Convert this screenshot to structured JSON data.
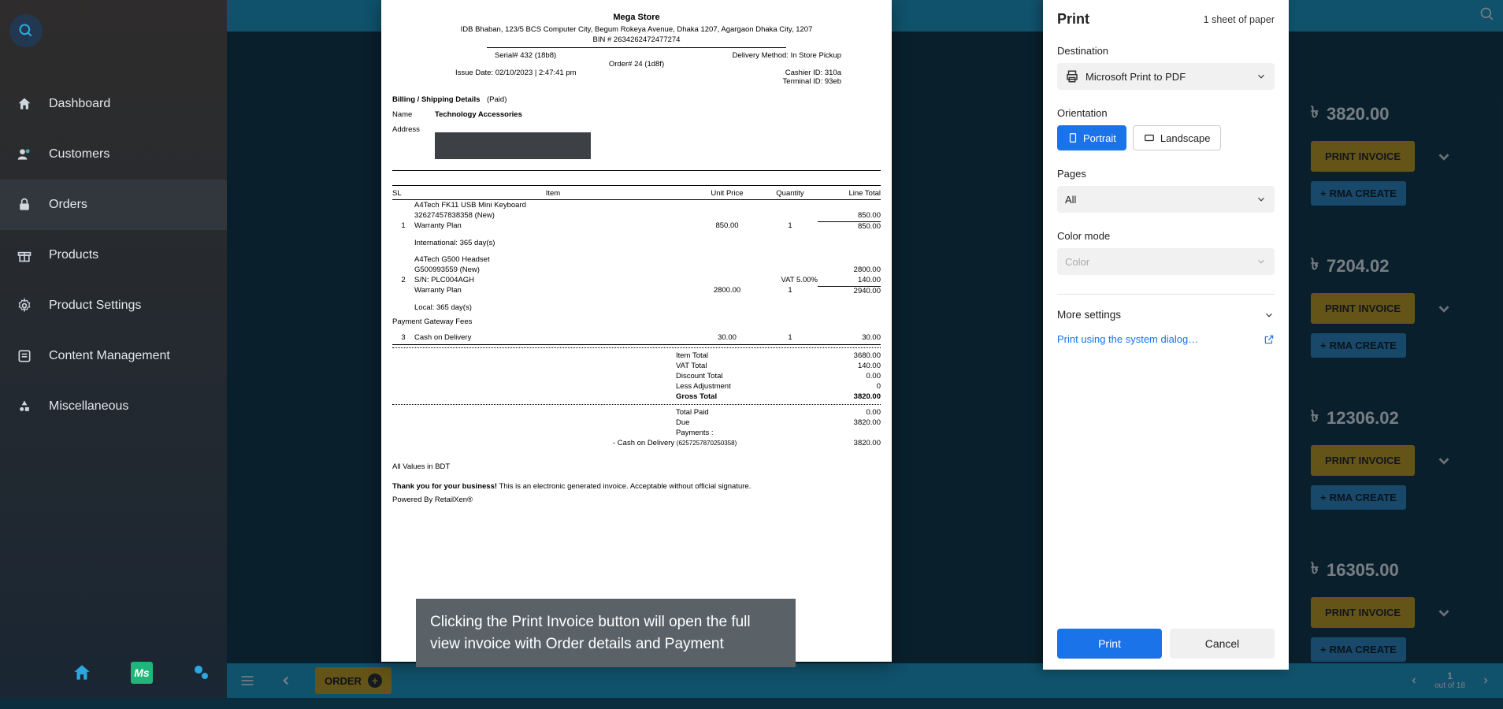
{
  "sidebar": {
    "items": [
      {
        "label": "Dashboard",
        "icon": "home"
      },
      {
        "label": "Customers",
        "icon": "user"
      },
      {
        "label": "Orders",
        "icon": "lock",
        "active": true
      },
      {
        "label": "Products",
        "icon": "gift"
      },
      {
        "label": "Product Settings",
        "icon": "gear"
      },
      {
        "label": "Content Management",
        "icon": "doc"
      },
      {
        "label": "Miscellaneous",
        "icon": "shapes"
      }
    ]
  },
  "orders": [
    {
      "amount": "3820.00",
      "print": "PRINT INVOICE",
      "rma": "RMA CREATE"
    },
    {
      "amount": "7204.02",
      "print": "PRINT INVOICE",
      "rma": "RMA CREATE"
    },
    {
      "amount": "12306.02",
      "print": "PRINT INVOICE",
      "rma": "RMA CREATE"
    },
    {
      "amount": "16305.00",
      "print": "PRINT INVOICE",
      "rma": "RMA CREATE"
    }
  ],
  "currency": "৳",
  "invoice": {
    "store": "Mega Store",
    "address": "IDB Bhaban, 123/5 BCS Computer City, Begum Rokeya Avenue, Dhaka 1207, Agargaon Dhaka City, 1207",
    "bin": "BIN # 2634262472477274",
    "serial": "Serial# 432 (18b8)",
    "order": "Order# 24 (1d8f)",
    "issue": "Issue Date: 02/10/2023 | 2:47:41 pm",
    "delivery": "Delivery Method: In Store Pickup",
    "cashier": "Cashier ID: 310a",
    "terminal": "Terminal ID: 93eb",
    "billing_label": "Billing / Shipping Details",
    "paid": "(Paid)",
    "name_k": "Name",
    "name_v": "Technology Accessories",
    "address_k": "Address",
    "headers": {
      "sl": "SL",
      "item": "Item",
      "up": "Unit Price",
      "qty": "Quantity",
      "lt": "Line Total"
    },
    "items": [
      {
        "sl": "1",
        "lines": [
          "A4Tech FK11 USB Mini Keyboard",
          "32627457838358 (New)"
        ],
        "plan": "Warranty Plan",
        "up": "850.00",
        "qty": "1",
        "lt": "850.00",
        "sub": "850.00",
        "intl": "International: 365 day(s)"
      },
      {
        "sl": "2",
        "lines": [
          "A4Tech G500 Headset",
          "G500993559 (New)",
          "S/N: PLC004AGH"
        ],
        "plan": "Warranty Plan",
        "up": "2800.00",
        "qty": "1",
        "vat_lbl": "VAT 5.00%",
        "lt": "2800.00",
        "vat_amt": "140.00",
        "sub": "2940.00",
        "intl": "Local: 365 day(s)"
      }
    ],
    "gateway_lbl": "Payment Gateway Fees",
    "gateway": {
      "sl": "3",
      "name": "Cash on Delivery",
      "up": "30.00",
      "qty": "1",
      "lt": "30.00"
    },
    "totals": [
      {
        "l": "Item Total",
        "v": "3680.00"
      },
      {
        "l": "VAT Total",
        "v": "140.00"
      },
      {
        "l": "Discount Total",
        "v": "0.00"
      },
      {
        "l": "Less Adjustment",
        "v": "0"
      },
      {
        "l": "Gross Total",
        "v": "3820.00",
        "bold": true
      }
    ],
    "paid_rows": [
      {
        "l": "Total Paid",
        "v": "0.00"
      },
      {
        "l": "Due",
        "v": "3820.00"
      }
    ],
    "payments_lbl": "Payments :",
    "payment_line_l": "- Cash on Delivery",
    "payment_line_ref": "(6257257870250358)",
    "payment_line_v": "3820.00",
    "all_values": "All Values in BDT",
    "thank": "Thank you for your business!",
    "thank_rest": " This is an electronic generated invoice. Acceptable without official signature.",
    "powered": "Powered By RetailXen®"
  },
  "tooltip": "Clicking the Print Invoice button will open the full view invoice with Order details and Payment",
  "print": {
    "title": "Print",
    "sheets": "1 sheet of paper",
    "dest_lbl": "Destination",
    "dest": "Microsoft Print to PDF",
    "orient_lbl": "Orientation",
    "portrait": "Portrait",
    "landscape": "Landscape",
    "pages_lbl": "Pages",
    "pages": "All",
    "color_lbl": "Color mode",
    "color": "Color",
    "more": "More settings",
    "system": "Print using the system dialog…",
    "print_btn": "Print",
    "cancel_btn": "Cancel"
  },
  "botbar": {
    "order": "ORDER",
    "page": "1",
    "outof": "out of 18"
  }
}
